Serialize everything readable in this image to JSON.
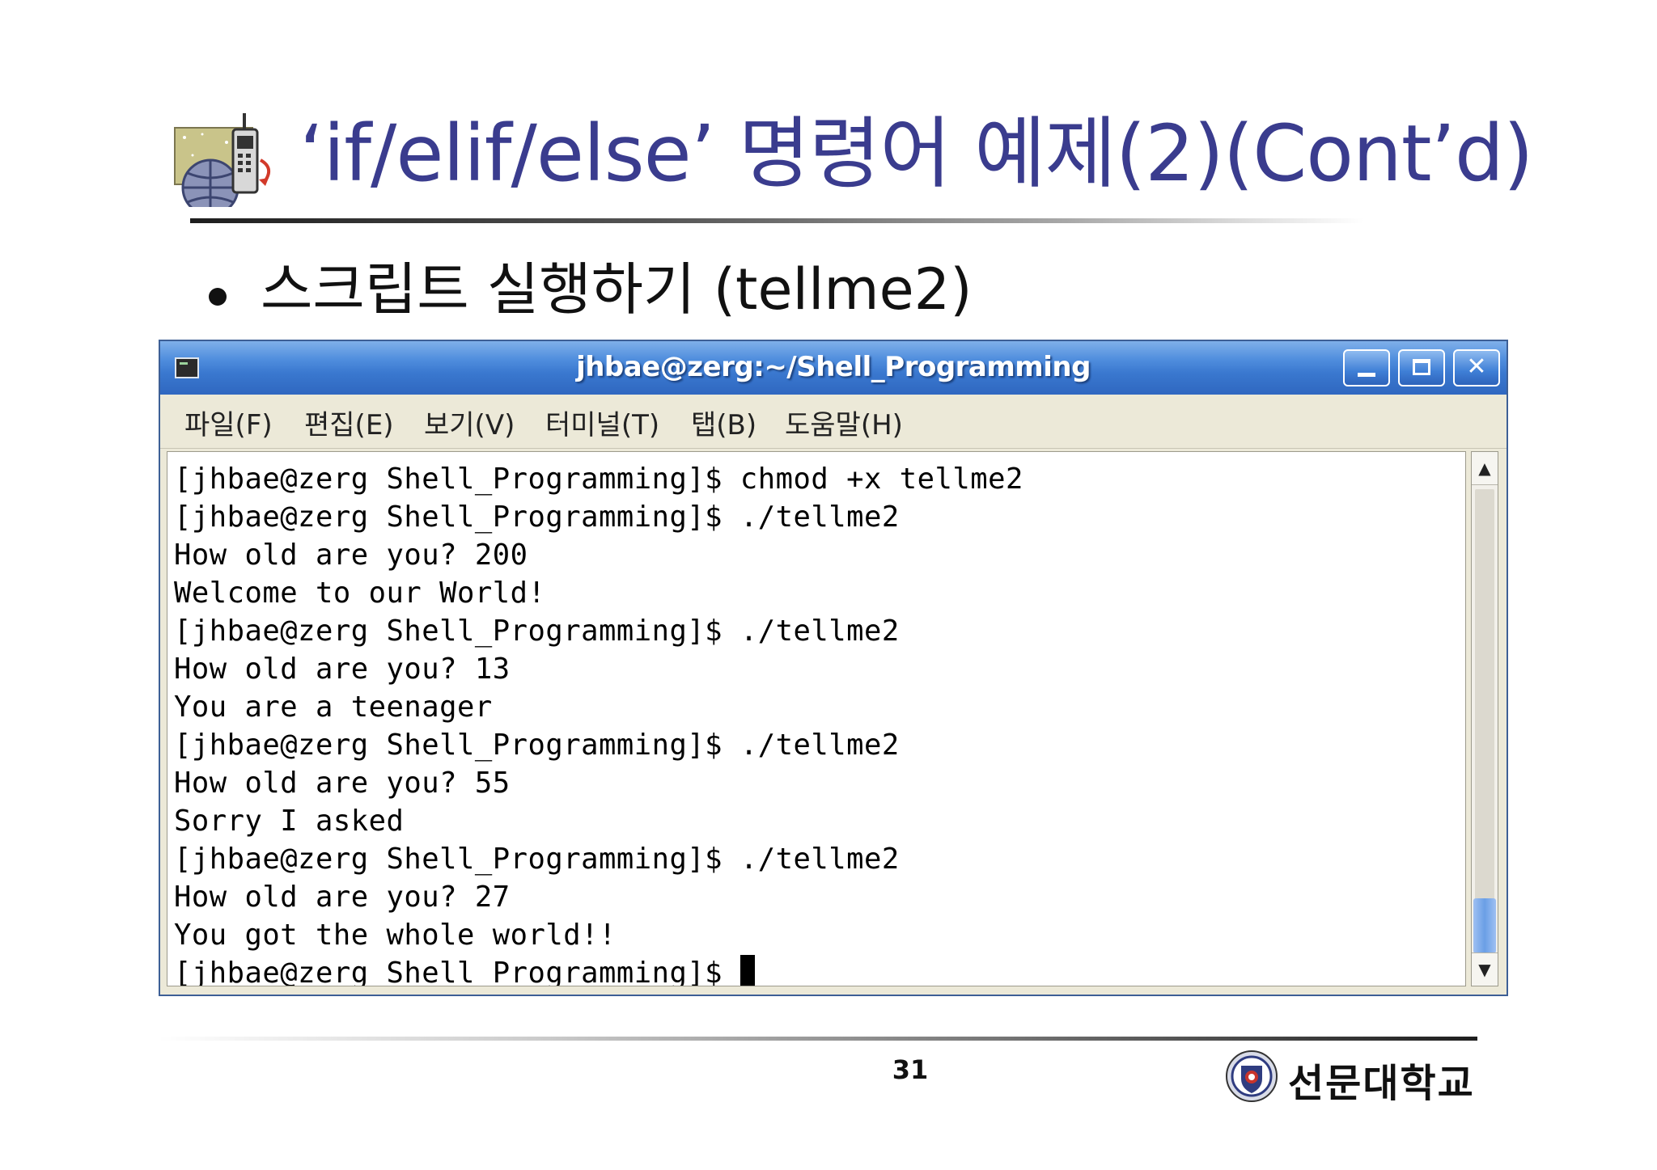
{
  "slide": {
    "title": "‘if/elif/else’ 명령어 예제(2)(Cont’d)",
    "bullet": "스크립트 실행하기 (tellme2)",
    "title_icon": "satellite-phone-globe-icon",
    "page_number": "31",
    "logo_text": "선문대학교",
    "logo_icon": "university-emblem-icon"
  },
  "window": {
    "title": "jhbae@zerg:~/Shell_Programming",
    "controls": {
      "minimize_icon": "minimize-icon",
      "maximize_icon": "maximize-icon",
      "close_label": "✕"
    },
    "menu": [
      "파일(F)",
      "편집(E)",
      "보기(V)",
      "터미널(T)",
      "탭(B)",
      "도움말(H)"
    ]
  },
  "terminal": {
    "lines": [
      "[jhbae@zerg Shell_Programming]$ chmod +x tellme2",
      "[jhbae@zerg Shell_Programming]$ ./tellme2",
      "How old are you? 200",
      "Welcome to our World!",
      "[jhbae@zerg Shell_Programming]$ ./tellme2",
      "How old are you? 13",
      "You are a teenager",
      "[jhbae@zerg Shell_Programming]$ ./tellme2",
      "How old are you? 55",
      "Sorry I asked",
      "[jhbae@zerg Shell_Programming]$ ./tellme2",
      "How old are you? 27",
      "You got the whole world!!",
      "[jhbae@zerg Shell_Programming]$ "
    ]
  },
  "colors": {
    "title": "#3a3c8e",
    "titlebar": "#3a78cf",
    "scrollbar_thumb": "#6a9fe6"
  }
}
